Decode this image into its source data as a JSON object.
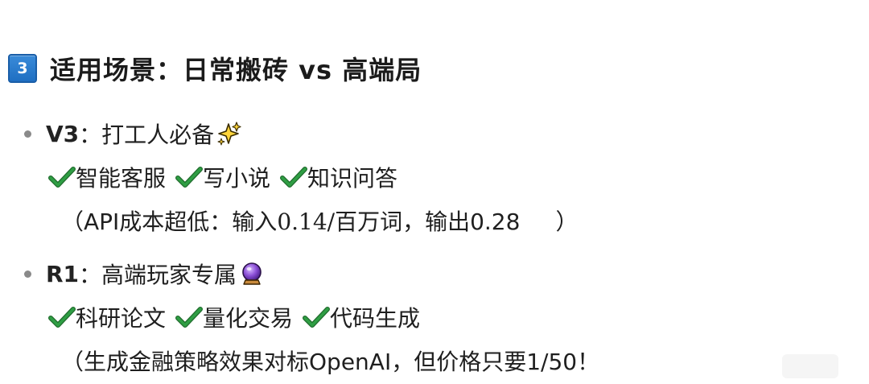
{
  "section": {
    "number": "3",
    "title": "适用场景：日常搬砖 vs 高端局",
    "badge_color": "#2a7bd0"
  },
  "items": [
    {
      "model": "V3",
      "desc": "：打工人必备",
      "icon": "sparkles-icon",
      "tags": [
        "智能客服",
        "写小说",
        "知识问答"
      ],
      "note_pre": "（API成本超低：输入",
      "note_serif": "0.14/百万词，",
      "note_post": " 输出0.28",
      "note_close": "）"
    },
    {
      "model": "R1",
      "desc": "：高端玩家专属",
      "icon": "crystal-ball-icon",
      "tags": [
        "科研论文",
        "量化交易",
        "代码生成"
      ],
      "note_pre": "（生成金融策略效果对标OpenAI，但价格只要1/50！"
    }
  ],
  "colors": {
    "check": "#2f9e44",
    "bullet": "#8a8a8a",
    "text": "#1f1f1f"
  }
}
